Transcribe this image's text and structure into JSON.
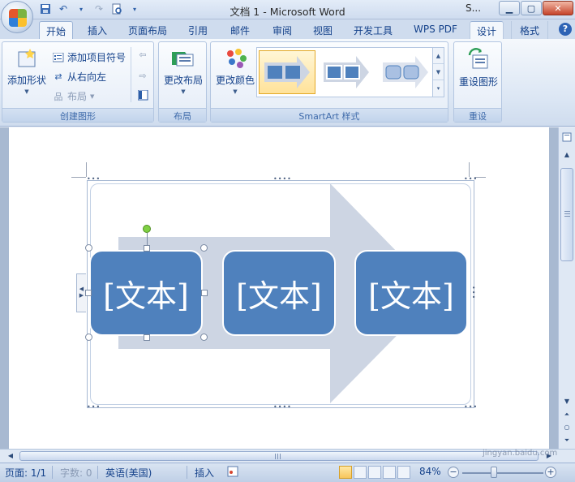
{
  "window": {
    "title": "文档 1 - Microsoft Word",
    "title_right": "S..."
  },
  "tabs": [
    "开始",
    "插入",
    "页面布局",
    "引用",
    "邮件",
    "审阅",
    "视图",
    "开发工具",
    "WPS PDF",
    "设计",
    "格式"
  ],
  "ribbon": {
    "create_group": {
      "label": "创建图形",
      "add_shape": "添加形状",
      "add_bullet": "添加项目符号",
      "right_to_left": "从右向左",
      "layout": "布局"
    },
    "layout_group": {
      "label": "布局",
      "change_layout": "更改布局"
    },
    "styles_group": {
      "label": "SmartArt 样式",
      "change_color": "更改颜色"
    },
    "reset_group": {
      "label": "重设",
      "reset_graphic": "重设图形"
    }
  },
  "smartart": {
    "boxes": [
      "[文本]",
      "[文本]",
      "[文本]"
    ],
    "box_color": "#4f81bd",
    "arrow_color": "#cdd5e3"
  },
  "status": {
    "page": "页面: 1/1",
    "words": "字数: 0",
    "language": "英语(美国)",
    "insert": "插入",
    "zoom": "84%"
  },
  "watermark": {
    "brand": "Baidu经验",
    "url": "jingyan.baidu.com"
  },
  "colors": {
    "accent": "#15428b",
    "ribbon_bg": "#dbe6f4",
    "doc_bg": "#a8b9d1"
  }
}
